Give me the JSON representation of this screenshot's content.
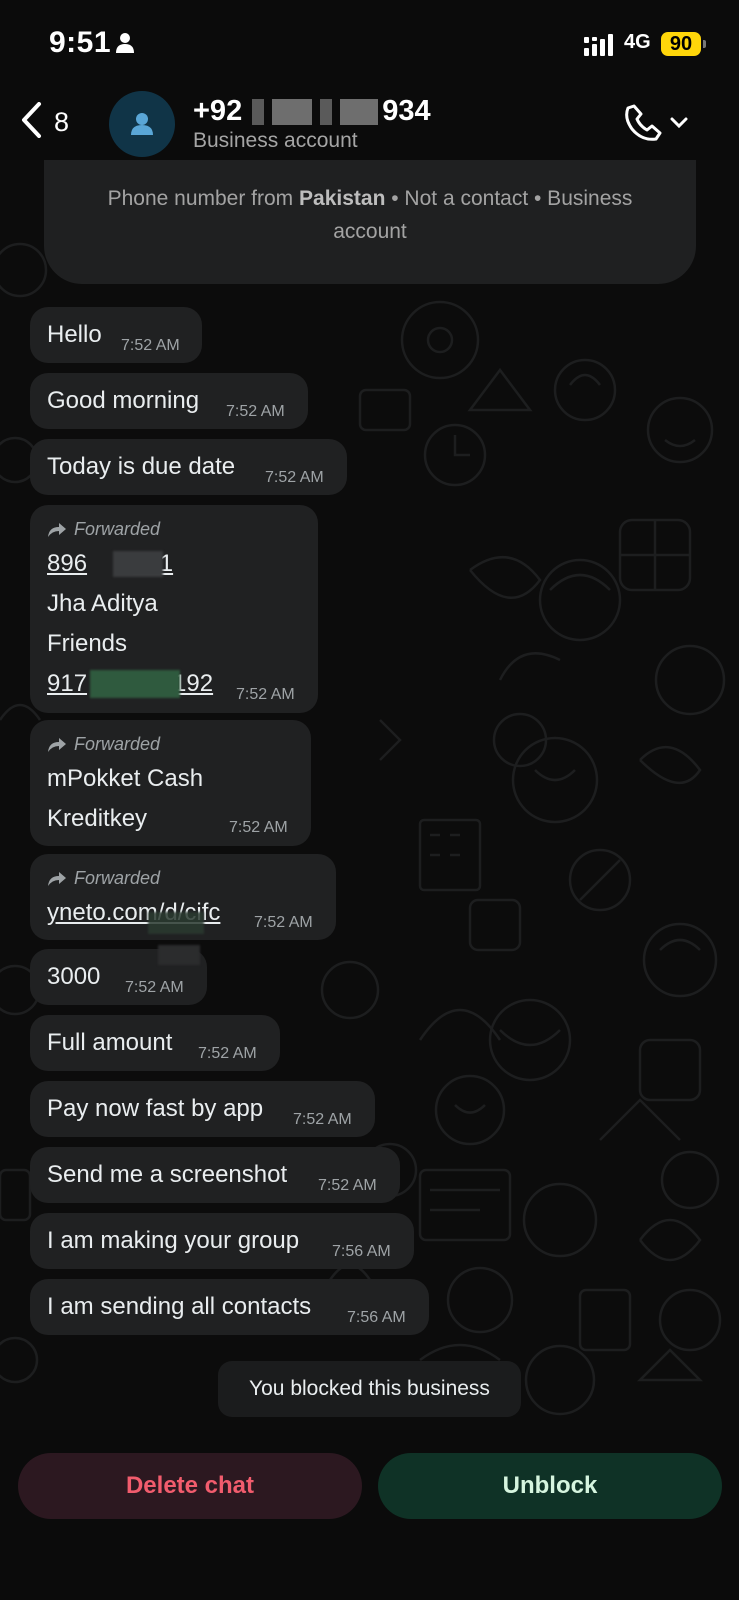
{
  "status_bar": {
    "time": "9:51",
    "network": "4G",
    "battery": "90"
  },
  "header": {
    "back_count": "8",
    "phone_prefix": "+92",
    "phone_suffix": "934",
    "subtitle": "Business account"
  },
  "info_card": {
    "text_prefix": "Phone number from ",
    "country": "Pakistan",
    "text_suffix": " • Not a contact • Business account"
  },
  "messages": [
    {
      "text": "Hello",
      "time": "7:52 AM"
    },
    {
      "text": "Good morning",
      "time": "7:52 AM"
    },
    {
      "text": "Today is due date",
      "time": "7:52 AM"
    },
    {
      "forwarded": "Forwarded",
      "lines": [
        "896",
        "201",
        "Jha Aditya",
        "Friends",
        "917",
        "192"
      ],
      "time": "7:52 AM"
    },
    {
      "forwarded": "Forwarded",
      "lines": [
        "mPokket Cash",
        "Kreditkey"
      ],
      "time": "7:52 AM"
    },
    {
      "forwarded": "Forwarded",
      "link": "yneto.com/d/cifc",
      "time": "7:52 AM"
    },
    {
      "text": "3000",
      "time": "7:52 AM"
    },
    {
      "text": "Full amount",
      "time": "7:52 AM"
    },
    {
      "text": "Pay now fast by app",
      "time": "7:52 AM"
    },
    {
      "text": "Send me a screenshot",
      "time": "7:52 AM"
    },
    {
      "text": "I am making your group",
      "time": "7:56 AM"
    },
    {
      "text": "I am sending all contacts",
      "time": "7:56 AM"
    }
  ],
  "system_notice": "You blocked this business",
  "actions": {
    "delete_label": "Delete chat",
    "unblock_label": "Unblock"
  },
  "colors": {
    "bubble": "#202122",
    "link": "#3cc26a",
    "delete": "#f15c6d",
    "unblock_bg": "#0f3226",
    "battery": "#ffd60a"
  }
}
